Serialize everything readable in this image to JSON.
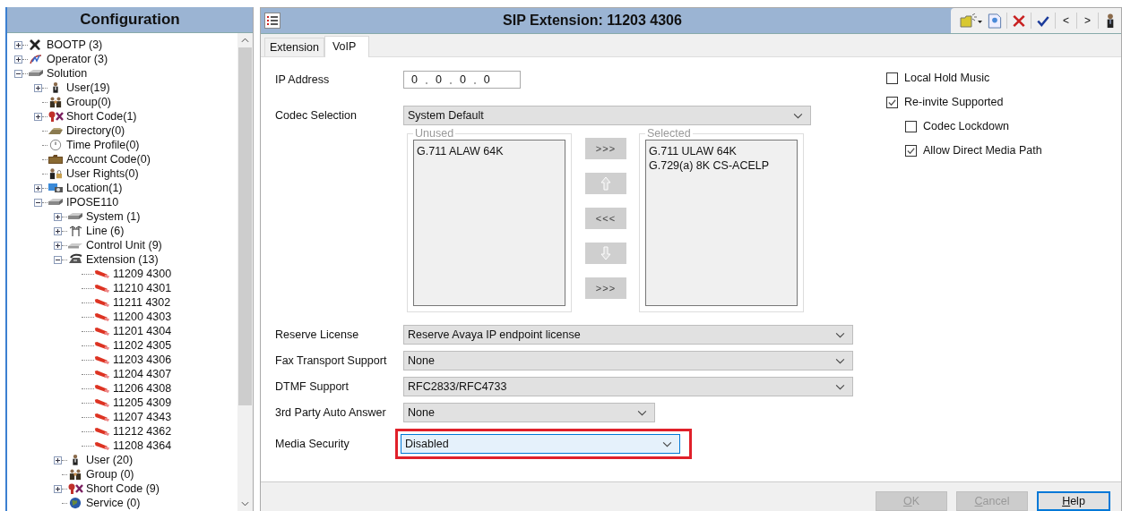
{
  "left_panel": {
    "title": "Configuration",
    "tree": [
      {
        "label": "BOOTP (3)",
        "kind": "bootp",
        "expanded": false
      },
      {
        "label": "Operator (3)",
        "kind": "operator",
        "expanded": false
      },
      {
        "label": "Solution",
        "kind": "server",
        "expanded": true,
        "children": [
          {
            "label": "User(19)",
            "kind": "user",
            "expanded": false
          },
          {
            "label": "Group(0)",
            "kind": "group"
          },
          {
            "label": "Short Code(1)",
            "kind": "shortcode",
            "expanded": false
          },
          {
            "label": "Directory(0)",
            "kind": "directory"
          },
          {
            "label": "Time Profile(0)",
            "kind": "clock"
          },
          {
            "label": "Account Code(0)",
            "kind": "account"
          },
          {
            "label": "User Rights(0)",
            "kind": "rights"
          },
          {
            "label": "Location(1)",
            "kind": "location",
            "expanded": false
          },
          {
            "label": "IPOSE110",
            "kind": "server",
            "expanded": true,
            "children": [
              {
                "label": "System (1)",
                "kind": "server",
                "expanded": false
              },
              {
                "label": "Line (6)",
                "kind": "line",
                "expanded": false
              },
              {
                "label": "Control Unit (9)",
                "kind": "unit",
                "expanded": false
              },
              {
                "label": "Extension (13)",
                "kind": "phone",
                "expanded": true,
                "children": [
                  {
                    "label": "11209 4300",
                    "kind": "extension"
                  },
                  {
                    "label": "11210 4301",
                    "kind": "extension"
                  },
                  {
                    "label": "11211 4302",
                    "kind": "extension"
                  },
                  {
                    "label": "11200 4303",
                    "kind": "extension"
                  },
                  {
                    "label": "11201 4304",
                    "kind": "extension"
                  },
                  {
                    "label": "11202 4305",
                    "kind": "extension"
                  },
                  {
                    "label": "11203 4306",
                    "kind": "extension"
                  },
                  {
                    "label": "11204 4307",
                    "kind": "extension"
                  },
                  {
                    "label": "11206 4308",
                    "kind": "extension"
                  },
                  {
                    "label": "11205 4309",
                    "kind": "extension"
                  },
                  {
                    "label": "11207 4343",
                    "kind": "extension"
                  },
                  {
                    "label": "11212 4362",
                    "kind": "extension"
                  },
                  {
                    "label": "11208 4364",
                    "kind": "extension"
                  }
                ]
              },
              {
                "label": "User (20)",
                "kind": "user",
                "expanded": false
              },
              {
                "label": "Group (0)",
                "kind": "group"
              },
              {
                "label": "Short Code (9)",
                "kind": "shortcode",
                "expanded": false
              },
              {
                "label": "Service (0)",
                "kind": "globe"
              }
            ]
          }
        ]
      }
    ]
  },
  "editor": {
    "title": "SIP Extension: 11203 4306",
    "toolbar": [
      {
        "kind": "new"
      },
      {
        "kind": "save"
      },
      {
        "kind": "delete"
      },
      {
        "kind": "validate"
      },
      {
        "kind": "text",
        "label": "<"
      },
      {
        "kind": "text",
        "label": ">"
      },
      {
        "kind": "user"
      }
    ],
    "tabs": [
      {
        "label": "Extension",
        "selected": false
      },
      {
        "label": "VoIP",
        "selected": true
      }
    ],
    "ip_address": {
      "label": "IP Address",
      "octets": [
        "0",
        "0",
        "0",
        "0"
      ]
    },
    "codec_selection": {
      "label": "Codec Selection",
      "value": "System Default",
      "unused": {
        "label": "Unused",
        "items": [
          "G.711 ALAW 64K"
        ]
      },
      "selected": {
        "label": "Selected",
        "items": [
          "G.711 ULAW 64K",
          "G.729(a) 8K CS-ACELP"
        ]
      },
      "move_buttons": [
        {
          "kind": "text",
          "label": ">>>"
        },
        {
          "kind": "up"
        },
        {
          "kind": "text",
          "label": "<<<"
        },
        {
          "kind": "down"
        },
        {
          "kind": "text",
          "label": ">>>"
        }
      ]
    },
    "fields": [
      {
        "label": "Reserve License",
        "value": "Reserve Avaya IP endpoint license",
        "kind": "wide",
        "highlighted": false,
        "focused": false
      },
      {
        "label": "Fax Transport Support",
        "value": "None",
        "kind": "wide",
        "highlighted": false,
        "focused": false
      },
      {
        "label": "DTMF Support",
        "value": "RFC2833/RFC4733",
        "kind": "wide",
        "highlighted": false,
        "focused": false
      },
      {
        "label": "3rd Party Auto Answer",
        "value": "None",
        "kind": "medium",
        "highlighted": false,
        "focused": false
      },
      {
        "label": "Media Security",
        "value": "Disabled",
        "kind": "short",
        "highlighted": true,
        "focused": true
      }
    ],
    "checkboxes": [
      {
        "label": "Local Hold Music",
        "checked": false
      },
      {
        "label": "Re-invite Supported",
        "checked": true,
        "children": [
          {
            "label": "Codec Lockdown",
            "checked": false
          },
          {
            "label": "Allow Direct Media Path",
            "checked": true
          }
        ]
      }
    ],
    "buttons": [
      {
        "label": "OK",
        "disabled": true,
        "default": false
      },
      {
        "label": "Cancel",
        "disabled": true,
        "default": false
      },
      {
        "label": "Help",
        "disabled": false,
        "default": true
      }
    ]
  }
}
